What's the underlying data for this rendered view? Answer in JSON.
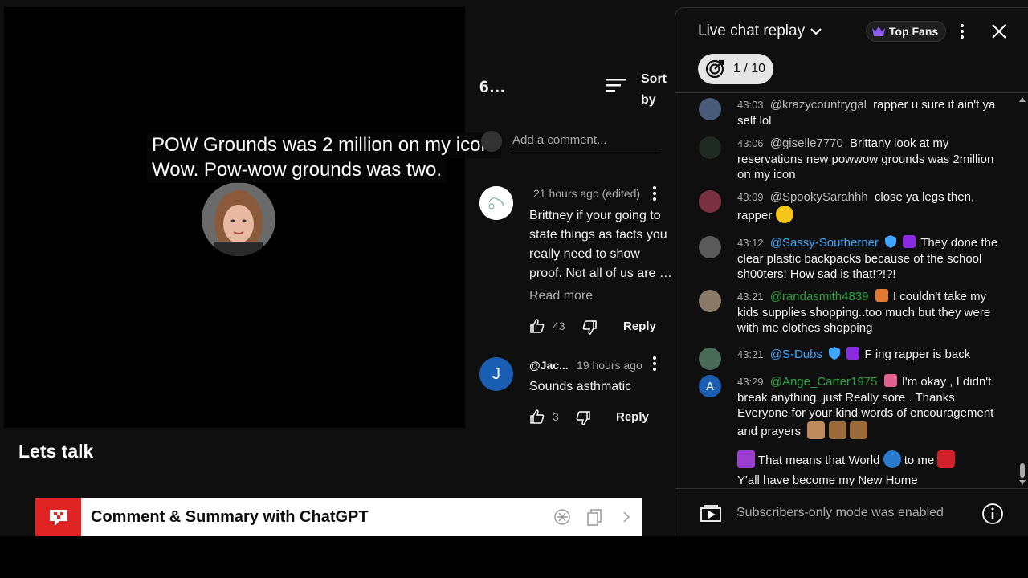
{
  "video": {
    "caption_line1": "POW Grounds was 2 million on my icon.",
    "caption_line2": "Wow. Pow-wow grounds was two.",
    "title": "Lets talk"
  },
  "extension_bar": {
    "title": "Comment & Summary with ChatGPT",
    "icons": [
      "chatgpt-logo-icon",
      "copy-icon",
      "chevron-right-icon"
    ],
    "brand_color": "#e02424"
  },
  "comments": {
    "count": "6…",
    "sort_label": "Sort by",
    "add_placeholder": "Add a comment...",
    "read_more": "Read more",
    "items": [
      {
        "meta": "21 hours ago (edited)",
        "text": "Brittney if your going to state things as facts you really need to show proof. Not all of us are …",
        "likes": "43",
        "reply": "Reply"
      },
      {
        "avatar_letter": "J",
        "author": "@Jac...",
        "meta": "19 hours ago",
        "text": "Sounds asthmatic",
        "likes": "3",
        "reply": "Reply"
      }
    ]
  },
  "chat": {
    "title": "Live chat replay",
    "top_fans": "Top Fans",
    "goal": "1 / 10",
    "footer": "Subscribers-only mode was enabled",
    "messages": [
      {
        "time": "43:03",
        "author": "@krazycountrygal",
        "text": "rapper u sure it ain't ya self lol"
      },
      {
        "time": "43:06",
        "author": "@giselle7770",
        "text": "Brittany look at my reservations new powwow grounds was 2million on my icon"
      },
      {
        "time": "43:09",
        "author": "@SpookySarahhh",
        "text": "close ya legs then, rapper"
      },
      {
        "time": "43:12",
        "author": "@Sassy-Southerner",
        "text": "They done the clear plastic backpacks because of the school sh00ters! How sad is that!?!?!"
      },
      {
        "time": "43:21",
        "author": "@randasmith4839",
        "text": "I couldn't take my kids supplies shopping..too much but they were with me clothes shopping"
      },
      {
        "time": "43:21",
        "author": "@S-Dubs",
        "text": "F ing rapper is back"
      },
      {
        "time": "43:29",
        "author": "@Ange_Carter1975",
        "text": "I'm okay , I didn't break anything, just Really sore . Thanks Everyone for your kind words of encouragement and prayers",
        "text2": "That means that World",
        "text3": "to me",
        "text4": "Y'all have become my New Home"
      }
    ],
    "c2_avatar_letter": "A"
  }
}
